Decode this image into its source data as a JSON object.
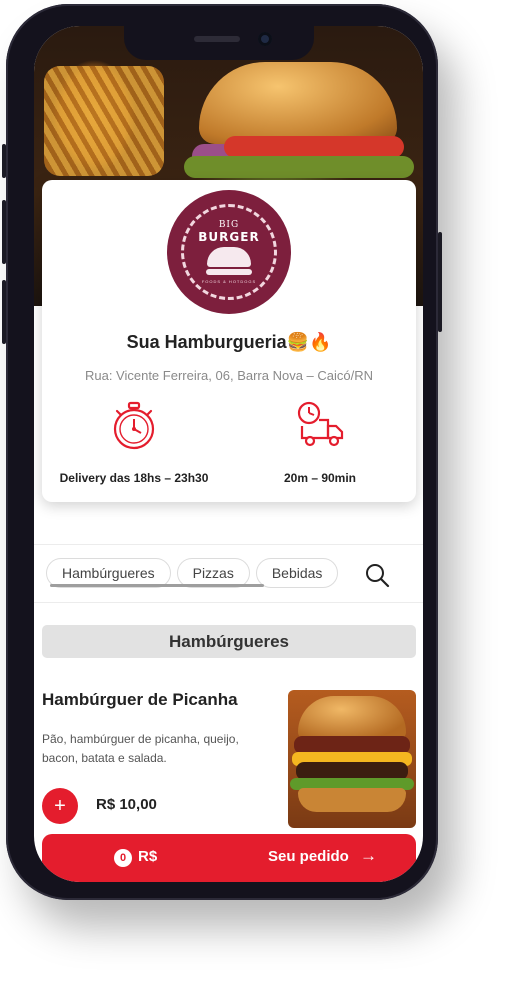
{
  "store": {
    "logo_text_top": "BIG",
    "logo_text_main": "BURGER",
    "logo_tagline": "FOODS & HOTDOGS",
    "name": "Sua Hamburgueria🍔🔥",
    "address": "Rua: Vicente Ferreira, 06, Barra Nova – Caicó/RN",
    "info": [
      {
        "icon": "stopwatch-icon",
        "text": "Delivery das 18hs – 23h30"
      },
      {
        "icon": "delivery-truck-icon",
        "text": "20m – 90min"
      }
    ]
  },
  "categories": {
    "tabs": [
      "Hambúrgueres",
      "Pizzas",
      "Bebidas"
    ],
    "search_icon": "search-icon"
  },
  "section": {
    "title": "Hambúrgueres"
  },
  "product": {
    "name": "Hambúrguer de Picanha",
    "description": "Pão, hambúrguer de picanha, queijo, bacon, batata e salada.",
    "price": "R$ 10,00",
    "add_label": "+"
  },
  "order_bar": {
    "count": "0",
    "currency": "R$",
    "label": "Seu pedido",
    "arrow": "→"
  },
  "colors": {
    "accent": "#e41d2d",
    "logo_bg": "#7d1f3d"
  }
}
